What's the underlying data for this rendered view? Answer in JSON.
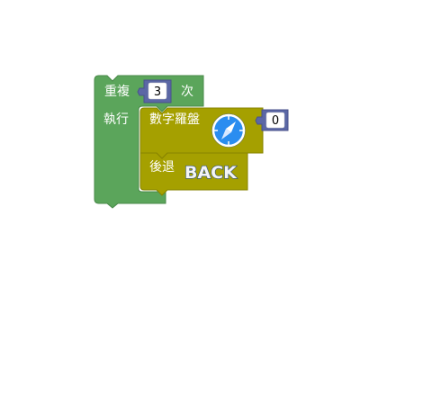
{
  "repeat_block": {
    "label_repeat": "重複",
    "times_value": "3",
    "label_times": "次",
    "label_do": "執行",
    "color": "#5ba55b"
  },
  "compass_block": {
    "label": "數字羅盤",
    "icon": "compass-icon",
    "value": "0",
    "color": "#a5a000"
  },
  "back_block": {
    "label": "後退",
    "image_text": "BACK",
    "color": "#a5a000"
  },
  "number_input_color": "#5b67a5"
}
